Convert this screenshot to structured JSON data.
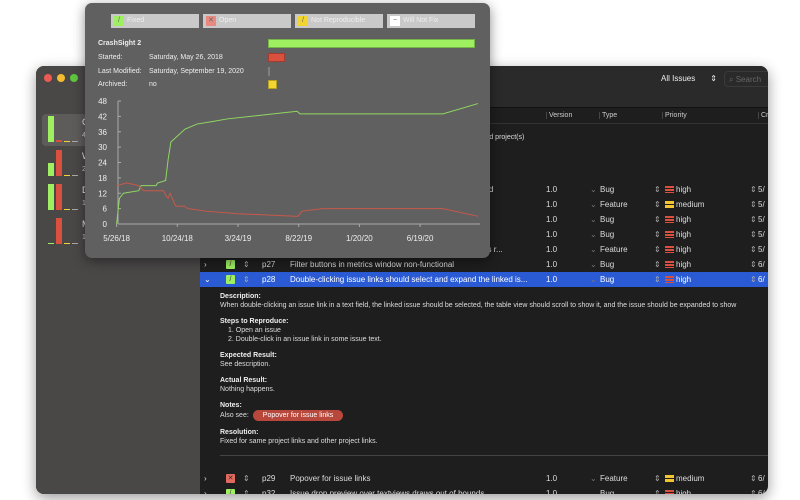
{
  "colors": {
    "fixed": "#9ef060",
    "open": "#d9503f",
    "not_repro": "#f2d530",
    "wont_fix": "#aaaaaa",
    "selection": "#2b5bd4"
  },
  "popover": {
    "legend": [
      {
        "label": "Fixed",
        "icon": "check-icon"
      },
      {
        "label": "Open",
        "icon": "x-icon"
      },
      {
        "label": "Not Reproducible",
        "icon": "slash-icon"
      },
      {
        "label": "Will Not Fix",
        "icon": "minus-icon"
      }
    ],
    "project": "CrashSight 2",
    "started_label": "Started:",
    "started": "Saturday, May 26, 2018",
    "modified_label": "Last Modified:",
    "modified": "Saturday, September 19, 2020",
    "archived_label": "Archived:",
    "archived": "no",
    "status_bars": {
      "fixed": 1.0,
      "open": 0.08,
      "wont_fix": 0.0,
      "not_repro": 0.04
    }
  },
  "chart_data": {
    "type": "line",
    "title": "",
    "xlabel": "",
    "ylabel": "",
    "ylim": [
      0,
      48
    ],
    "yticks": [
      0,
      6,
      12,
      18,
      24,
      30,
      36,
      42,
      48
    ],
    "xlim": [
      "2018-05-22",
      "2020-11-15"
    ],
    "xticks": [
      {
        "date": "2018-05-26",
        "label": "5/26/18"
      },
      {
        "date": "2018-10-24",
        "label": "10/24/18"
      },
      {
        "date": "2019-03-24",
        "label": "3/24/19"
      },
      {
        "date": "2019-08-22",
        "label": "8/22/19"
      },
      {
        "date": "2020-01-20",
        "label": "1/20/20"
      },
      {
        "date": "2020-06-19",
        "label": "6/19/20"
      }
    ],
    "series": [
      {
        "name": "Fixed",
        "color": "#8fd860",
        "points": [
          [
            "2018-05-26",
            0
          ],
          [
            "2018-06-02",
            10
          ],
          [
            "2018-06-12",
            12
          ],
          [
            "2018-07-20",
            13
          ],
          [
            "2018-07-26",
            15
          ],
          [
            "2018-09-01",
            15
          ],
          [
            "2018-09-05",
            16
          ],
          [
            "2018-09-25",
            17
          ],
          [
            "2018-10-01",
            25
          ],
          [
            "2018-10-08",
            32
          ],
          [
            "2018-10-22",
            34
          ],
          [
            "2018-11-12",
            37
          ],
          [
            "2018-12-12",
            39
          ],
          [
            "2019-01-20",
            40
          ],
          [
            "2019-02-25",
            41
          ],
          [
            "2019-08-18",
            44
          ],
          [
            "2019-08-25",
            43
          ],
          [
            "2020-08-15",
            43
          ],
          [
            "2020-11-10",
            47
          ]
        ]
      },
      {
        "name": "Open",
        "color": "#c8584a",
        "points": [
          [
            "2018-05-26",
            15
          ],
          [
            "2018-06-20",
            16
          ],
          [
            "2018-07-20",
            15
          ],
          [
            "2018-08-01",
            13
          ],
          [
            "2018-09-20",
            13
          ],
          [
            "2018-09-26",
            11
          ],
          [
            "2018-10-01",
            10
          ],
          [
            "2018-10-06",
            12
          ],
          [
            "2018-10-20",
            7
          ],
          [
            "2018-11-10",
            7
          ],
          [
            "2018-11-20",
            6
          ],
          [
            "2019-01-05",
            5
          ],
          [
            "2019-03-24",
            4
          ],
          [
            "2019-08-20",
            3
          ],
          [
            "2019-08-30",
            5
          ],
          [
            "2019-10-20",
            6
          ],
          [
            "2020-08-15",
            6
          ],
          [
            "2020-11-10",
            3
          ]
        ]
      }
    ]
  },
  "sidebar": [
    {
      "name": "C",
      "count": "4",
      "bars": [
        1.0,
        0.08,
        0.04,
        0.04
      ]
    },
    {
      "name": "W",
      "count": "2",
      "bars": [
        0.5,
        1.0,
        0.04,
        0.04
      ]
    },
    {
      "name": "D",
      "count": "1",
      "bars": [
        1.0,
        1.0,
        0.04,
        0.04
      ]
    },
    {
      "name": "M",
      "count": "1",
      "bars": [
        0.04,
        1.0,
        0.04,
        0.04
      ]
    }
  ],
  "toolbar": {
    "filter": "All Issues",
    "search_placeholder": "Search"
  },
  "columns": {
    "version": "Version",
    "type": "Type",
    "priority": "Priority",
    "created": "Cr"
  },
  "empty_hint": "cted project(s)",
  "rows": [
    {
      "status": "",
      "id": "",
      "title": "tted",
      "version": "1.0",
      "type": "Bug",
      "priority": "high",
      "created": "5/"
    },
    {
      "status": "",
      "id": "",
      "title": "xt",
      "version": "1.0",
      "type": "Feature",
      "priority": "medium",
      "created": "5/"
    },
    {
      "status": "",
      "id": "",
      "title": "",
      "version": "1.0",
      "type": "Bug",
      "priority": "high",
      "created": "5/"
    },
    {
      "status": "",
      "id": "",
      "title": "",
      "version": "1.0",
      "type": "Bug",
      "priority": "high",
      "created": "5/"
    },
    {
      "status": "",
      "id": "",
      "title": "hat issue's r...",
      "version": "1.0",
      "type": "Feature",
      "priority": "high",
      "created": "5/"
    },
    {
      "status": "fixed",
      "id": "p27",
      "title": "Filter buttons in metrics window non-functional",
      "version": "1.0",
      "type": "Bug",
      "priority": "high",
      "created": "6/"
    },
    {
      "status": "fixed",
      "id": "p28",
      "title": "Double-clicking issue links should select and expand the linked is...",
      "version": "1.0",
      "type": "Bug",
      "priority": "high",
      "created": "6/"
    },
    {
      "status": "open",
      "id": "p29",
      "title": "Popover for issue links",
      "version": "1.0",
      "type": "Feature",
      "priority": "medium",
      "created": "6/"
    },
    {
      "status": "fixed",
      "id": "p32",
      "title": "Issue drop preview over textviews draws out of bounds",
      "version": "1.0",
      "type": "Bug",
      "priority": "high",
      "created": "6/"
    }
  ],
  "detail": {
    "description_label": "Description:",
    "description": "When double-clicking an issue link in a text field, the linked issue should be selected, the table view should scroll to show it, and the issue should be expanded to show",
    "steps_label": "Steps to Reproduce:",
    "steps": [
      "1.   Open an issue",
      "2.   Double-click in an issue link in some issue text."
    ],
    "expected_label": "Expected Result:",
    "expected": "See description.",
    "actual_label": "Actual Result:",
    "actual": "Nothing happens.",
    "notes_label": "Notes:",
    "also_see": "Also see:",
    "link": "Popover for issue links",
    "resolution_label": "Resolution:",
    "resolution": "Fixed for same project links and other project links."
  }
}
